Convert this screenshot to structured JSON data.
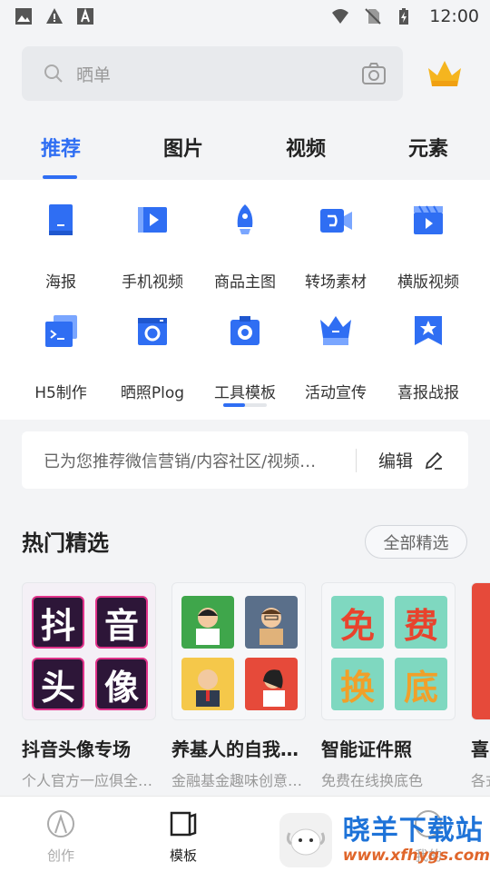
{
  "status_bar": {
    "time": "12:00",
    "left_icons": [
      "image-icon",
      "warning-icon",
      "a-icon"
    ],
    "right_icons": [
      "wifi-icon",
      "no-sim-icon",
      "battery-charging-icon"
    ]
  },
  "search": {
    "placeholder": "晒单",
    "left_icon": "search-icon",
    "right_icon": "camera-icon",
    "vip_icon": "crown-icon"
  },
  "tabs": [
    {
      "label": "推荐",
      "active": true
    },
    {
      "label": "图片",
      "active": false
    },
    {
      "label": "视频",
      "active": false
    },
    {
      "label": "元素",
      "active": false
    }
  ],
  "categories": [
    {
      "label": "海报",
      "icon": "poster-icon"
    },
    {
      "label": "手机视频",
      "icon": "phone-video-icon"
    },
    {
      "label": "商品主图",
      "icon": "rocket-icon"
    },
    {
      "label": "转场素材",
      "icon": "transition-camera-icon"
    },
    {
      "label": "横版视频",
      "icon": "clapperboard-icon"
    },
    {
      "label": "H5制作",
      "icon": "h5-terminal-icon"
    },
    {
      "label": "晒照Plog",
      "icon": "photo-camera-icon"
    },
    {
      "label": "工具模板",
      "icon": "tool-camera-icon"
    },
    {
      "label": "活动宣传",
      "icon": "crown-icon"
    },
    {
      "label": "喜报战报",
      "icon": "star-flag-icon"
    }
  ],
  "recommend_bar": {
    "text": "已为您推荐微信营销/内容社区/视频…",
    "edit_label": "编辑",
    "edit_icon": "pencil-icon"
  },
  "hot_section": {
    "title": "热门精选",
    "all_button": "全部精选"
  },
  "cards": [
    {
      "title": "抖音头像专场",
      "subtitle": "个人官方一应俱全…",
      "tiles": [
        "抖",
        "音",
        "头",
        "像"
      ]
    },
    {
      "title": "养基人的自我…",
      "subtitle": "金融基金趣味创意…"
    },
    {
      "title": "智能证件照",
      "subtitle": "免费在线换底色",
      "tiles": [
        "免",
        "费",
        "换",
        "底"
      ]
    },
    {
      "title": "喜",
      "subtitle": "各式"
    }
  ],
  "bottom_nav": [
    {
      "label": "创作",
      "icon": "compass-icon",
      "active": false
    },
    {
      "label": "模板",
      "icon": "template-icon",
      "active": true
    },
    {
      "label": "我的",
      "icon": "profile-icon",
      "active": false
    }
  ],
  "watermark": {
    "text": "晓羊下载站",
    "url": "www.xfhygs.com"
  },
  "colors": {
    "accent": "#2f6ef3",
    "background": "#f3f4f6",
    "icon_blue": "#2f6ef3",
    "crown_gold": "#f5b51f"
  }
}
